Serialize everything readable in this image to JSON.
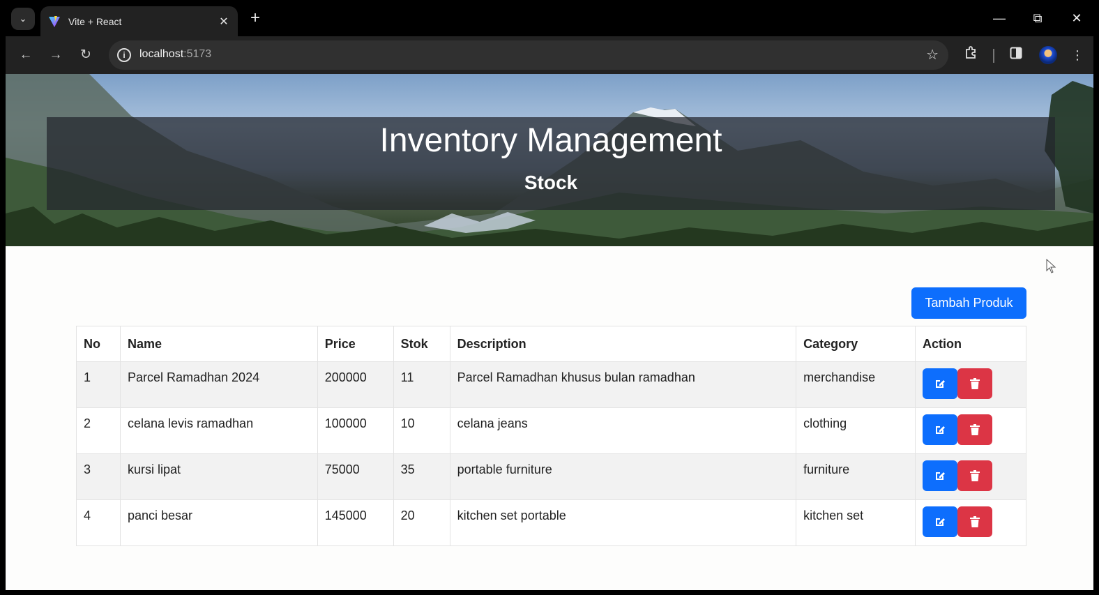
{
  "browser": {
    "tab_title": "Vite + React",
    "url_host": "localhost",
    "url_port": ":5173"
  },
  "header": {
    "title": "Inventory Management",
    "subtitle": "Stock"
  },
  "toolbar": {
    "add_label": "Tambah Produk"
  },
  "table": {
    "columns": [
      "No",
      "Name",
      "Price",
      "Stok",
      "Description",
      "Category",
      "Action"
    ],
    "rows": [
      {
        "no": "1",
        "name": "Parcel Ramadhan 2024",
        "price": "200000",
        "stok": "11",
        "description": "Parcel Ramadhan khusus bulan ramadhan",
        "category": "merchandise"
      },
      {
        "no": "2",
        "name": "celana levis ramadhan",
        "price": "100000",
        "stok": "10",
        "description": "celana jeans",
        "category": "clothing"
      },
      {
        "no": "3",
        "name": "kursi lipat",
        "price": "75000",
        "stok": "35",
        "description": "portable furniture",
        "category": "furniture"
      },
      {
        "no": "4",
        "name": "panci besar",
        "price": "145000",
        "stok": "20",
        "description": "kitchen set portable",
        "category": "kitchen set"
      }
    ]
  },
  "colors": {
    "primary": "#0d6efd",
    "danger": "#dc3545"
  },
  "icons": {
    "edit": "pen-to-square-icon",
    "delete": "trash-icon"
  }
}
